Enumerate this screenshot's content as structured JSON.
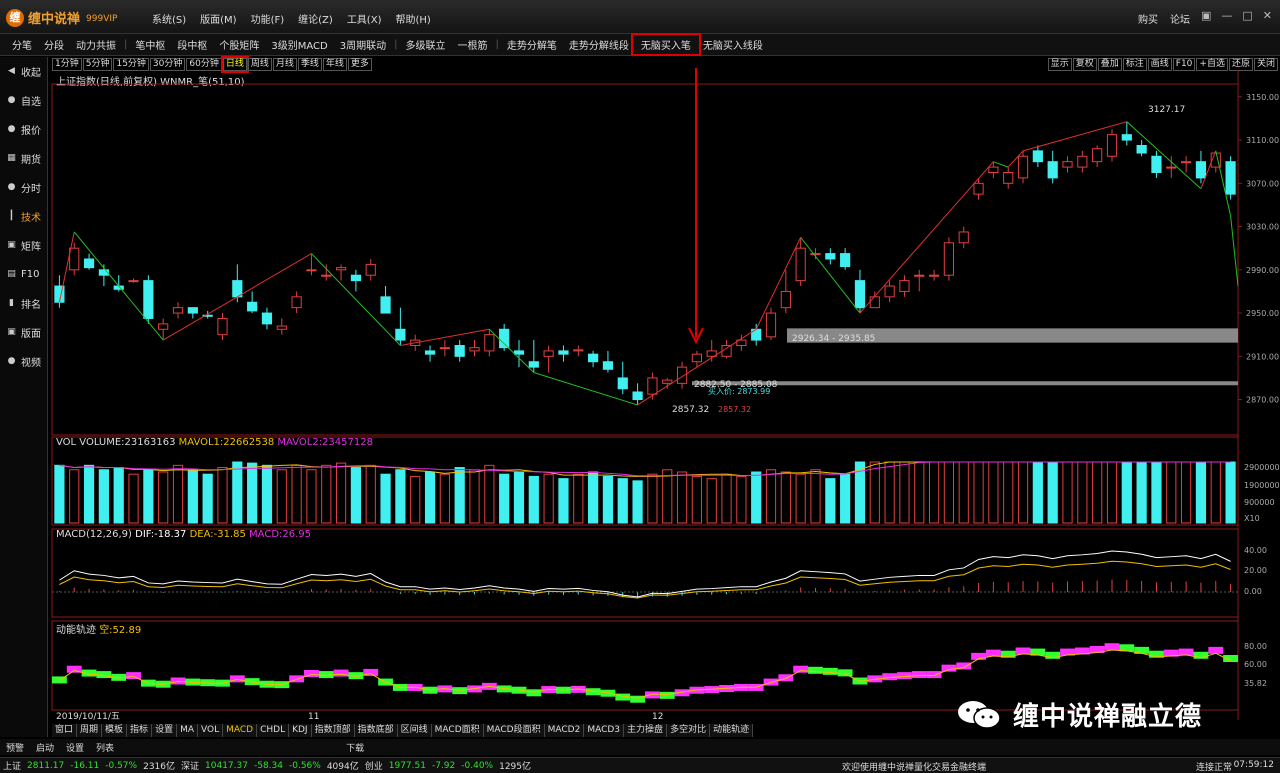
{
  "app": {
    "title": "缠中说禅",
    "vip": "999VIP",
    "logo_glyph": "缠",
    "menu": [
      "系统(S)",
      "版面(M)",
      "功能(F)",
      "缠论(Z)",
      "工具(X)",
      "帮助(H)"
    ],
    "top_right": [
      "购买",
      "论坛"
    ],
    "window_buttons": [
      "▣",
      "—",
      "□",
      "✕"
    ]
  },
  "toolbar": [
    "分笔",
    "分段",
    "动力共振",
    "|",
    "笔中枢",
    "段中枢",
    "个股矩阵",
    "3级别MACD",
    "3周期联动",
    "|",
    "多级联立",
    "一根筋",
    "|",
    "走势分解笔",
    "走势分解线段",
    "无脑买入笔",
    "无脑买入线段"
  ],
  "toolbar_highlight": "无脑买入笔",
  "sidebar": [
    {
      "label": "收起",
      "icon": "chevron-left-icon",
      "glyph": "◀"
    },
    {
      "label": "自选",
      "icon": "star-icon",
      "glyph": "●"
    },
    {
      "label": "报价",
      "icon": "quote-icon",
      "glyph": "●"
    },
    {
      "label": "期货",
      "icon": "futures-icon",
      "glyph": "▦"
    },
    {
      "label": "分时",
      "icon": "clock-icon",
      "glyph": "●"
    },
    {
      "label": "技术",
      "icon": "candlestick-icon",
      "glyph": "┃"
    },
    {
      "label": "矩阵",
      "icon": "matrix-icon",
      "glyph": "▣"
    },
    {
      "label": "F10",
      "icon": "f10-icon",
      "glyph": "▤"
    },
    {
      "label": "排名",
      "icon": "ranking-icon",
      "glyph": "▮"
    },
    {
      "label": "版面",
      "icon": "layout-icon",
      "glyph": "▣"
    },
    {
      "label": "视频",
      "icon": "video-icon",
      "glyph": "●"
    }
  ],
  "sidebar_active": "技术",
  "periods": [
    "1分钟",
    "5分钟",
    "15分钟",
    "30分钟",
    "60分钟",
    "日线",
    "周线",
    "月线",
    "季线",
    "年线",
    "更多"
  ],
  "period_active": "日线",
  "right_tools": [
    "显示",
    "复权",
    "叠加",
    "标注",
    "画线",
    "F10",
    "+自选",
    "还原",
    "关闭"
  ],
  "chart_title": "上证指数(日线,前复权) WNMR_笔(51,10)",
  "vol_label": "VOL VOLUME:23163163",
  "vol_ma1": "MAVOL1:22662538",
  "vol_ma2": "MAVOL2:23457128",
  "macd_label": "MACD(12,26,9)",
  "macd_dif": "DIF:-18.37",
  "macd_dea": "DEA:-31.85",
  "macd_val": "MACD:26.95",
  "dn_label": "动能轨迹",
  "dn_val": "空:52.89",
  "annotations": {
    "high": "3127.17",
    "low": "2857.32",
    "zone1": "2926.34 - 2935.85",
    "zone2": "2882.50 - 2885.08",
    "buy_price": "买入价: 2873.99",
    "buy_point": "2857.32"
  },
  "price_axis": [
    "3150.00",
    "3110.00",
    "3070.00",
    "3030.00",
    "2990.00",
    "2950.00",
    "2910.00",
    "2870.00"
  ],
  "vol_axis": [
    "2900000",
    "1900000",
    "900000",
    "X10"
  ],
  "macd_axis": [
    "40.00",
    "20.00",
    "0.00"
  ],
  "dn_axis": [
    "80.00",
    "60.00",
    "35.82"
  ],
  "date_axis": {
    "start": "2019/10/11/五",
    "m11": "11",
    "m12": "12"
  },
  "bottom_tabs": [
    "窗口",
    "周期",
    "模板",
    "指标",
    "设置",
    "MA",
    "VOL",
    "MACD",
    "CHDL",
    "KDJ",
    "指数顶部",
    "指数底部",
    "区间线",
    "MACD面积",
    "MACD段面积",
    "MACD2",
    "MACD3",
    "主力操盘",
    "多空对比",
    "动能轨迹"
  ],
  "bottom_tab_active": "MACD",
  "bottom_bar": [
    "预警",
    "启动",
    "设置",
    "列表",
    "下载"
  ],
  "status": {
    "sh_name": "上证",
    "sh_val": "2811.17",
    "sh_chg": "-16.11",
    "sh_pct": "-0.57%",
    "sh_amt": "2316亿",
    "sz_name": "深证",
    "sz_val": "10417.37",
    "sz_chg": "-58.34",
    "sz_pct": "-0.56%",
    "sz_amt": "4094亿",
    "cy_name": "创业",
    "cy_val": "1977.51",
    "cy_chg": "-7.92",
    "cy_pct": "-0.40%",
    "cy_amt": "1295亿",
    "message": "欢迎使用缠中说禅量化交易金融终端",
    "conn": "连接正常",
    "time": "07:59:12"
  },
  "watermark": "缠中说禅融立德",
  "colors": {
    "up": "#e04040",
    "down": "#40f0f0",
    "accent": "#f0a030",
    "highlight": "#e00000",
    "bi_up": "#e03030",
    "bi_down": "#20c020"
  },
  "chart_data": {
    "type": "candlestick",
    "ohlc": [
      [
        2975,
        2985,
        2955,
        2960
      ],
      [
        2990,
        3015,
        2985,
        3010
      ],
      [
        3000,
        3005,
        2990,
        2992
      ],
      [
        2990,
        2995,
        2975,
        2985
      ],
      [
        2975,
        2985,
        2970,
        2972
      ],
      [
        2980,
        2982,
        2978,
        2980
      ],
      [
        2980,
        2985,
        2940,
        2945
      ],
      [
        2935,
        2945,
        2925,
        2940
      ],
      [
        2950,
        2960,
        2945,
        2955
      ],
      [
        2955,
        2955,
        2945,
        2950
      ],
      [
        2948,
        2952,
        2945,
        2947
      ],
      [
        2930,
        2950,
        2925,
        2945
      ],
      [
        2980,
        2995,
        2960,
        2965
      ],
      [
        2960,
        2970,
        2950,
        2952
      ],
      [
        2950,
        2955,
        2935,
        2940
      ],
      [
        2935,
        2945,
        2930,
        2938
      ],
      [
        2955,
        2970,
        2950,
        2965
      ],
      [
        2990,
        3005,
        2985,
        2990
      ],
      [
        2985,
        2995,
        2980,
        2985
      ],
      [
        2990,
        2995,
        2980,
        2992
      ],
      [
        2985,
        2990,
        2970,
        2980
      ],
      [
        2985,
        3000,
        2980,
        2995
      ],
      [
        2965,
        2975,
        2950,
        2950
      ],
      [
        2935,
        2955,
        2920,
        2925
      ],
      [
        2920,
        2930,
        2915,
        2925
      ],
      [
        2915,
        2920,
        2905,
        2912
      ],
      [
        2918,
        2925,
        2910,
        2918
      ],
      [
        2920,
        2925,
        2905,
        2910
      ],
      [
        2915,
        2925,
        2910,
        2918
      ],
      [
        2915,
        2935,
        2910,
        2930
      ],
      [
        2935,
        2940,
        2915,
        2918
      ],
      [
        2915,
        2925,
        2900,
        2912
      ],
      [
        2905,
        2925,
        2895,
        2900
      ],
      [
        2910,
        2920,
        2895,
        2915
      ],
      [
        2915,
        2920,
        2905,
        2912
      ],
      [
        2915,
        2920,
        2910,
        2916
      ],
      [
        2912,
        2915,
        2900,
        2905
      ],
      [
        2905,
        2915,
        2895,
        2898
      ],
      [
        2890,
        2905,
        2875,
        2880
      ],
      [
        2877,
        2885,
        2865,
        2870
      ],
      [
        2875,
        2895,
        2870,
        2890
      ],
      [
        2885,
        2890,
        2880,
        2888
      ],
      [
        2885,
        2905,
        2880,
        2900
      ],
      [
        2905,
        2915,
        2900,
        2912
      ],
      [
        2910,
        2925,
        2905,
        2915
      ],
      [
        2910,
        2925,
        2908,
        2920
      ],
      [
        2920,
        2930,
        2915,
        2925
      ],
      [
        2935,
        2940,
        2920,
        2925
      ],
      [
        2928,
        2955,
        2925,
        2950
      ],
      [
        2955,
        2990,
        2950,
        2970
      ],
      [
        2980,
        3020,
        2975,
        3010
      ],
      [
        3005,
        3010,
        3000,
        3005
      ],
      [
        3005,
        3010,
        2995,
        3000
      ],
      [
        3005,
        3010,
        2990,
        2993
      ],
      [
        2980,
        2990,
        2950,
        2955
      ],
      [
        2955,
        2970,
        2955,
        2965
      ],
      [
        2965,
        2980,
        2960,
        2975
      ],
      [
        2970,
        2985,
        2965,
        2980
      ],
      [
        2985,
        2990,
        2970,
        2985
      ],
      [
        2985,
        2990,
        2980,
        2985
      ],
      [
        2985,
        3020,
        2980,
        3015
      ],
      [
        3015,
        3030,
        3010,
        3025
      ],
      [
        3060,
        3075,
        3055,
        3070
      ],
      [
        3080,
        3090,
        3075,
        3085
      ],
      [
        3070,
        3085,
        3065,
        3080
      ],
      [
        3075,
        3100,
        3070,
        3095
      ],
      [
        3100,
        3105,
        3085,
        3090
      ],
      [
        3090,
        3100,
        3070,
        3075
      ],
      [
        3085,
        3095,
        3080,
        3090
      ],
      [
        3085,
        3100,
        3080,
        3095
      ],
      [
        3090,
        3105,
        3085,
        3102
      ],
      [
        3095,
        3120,
        3090,
        3115
      ],
      [
        3115,
        3127,
        3105,
        3110
      ],
      [
        3105,
        3110,
        3095,
        3098
      ],
      [
        3095,
        3100,
        3075,
        3080
      ],
      [
        3085,
        3095,
        3075,
        3085
      ],
      [
        3090,
        3095,
        3080,
        3090
      ],
      [
        3090,
        3100,
        3070,
        3075
      ],
      [
        3085,
        3100,
        3080,
        3098
      ],
      [
        3090,
        3095,
        3055,
        3060
      ]
    ],
    "volume": [
      1.3,
      1.2,
      1.3,
      1.2,
      1.25,
      1.1,
      1.2,
      1.15,
      1.3,
      1.2,
      1.1,
      1.25,
      1.4,
      1.35,
      1.3,
      1.2,
      1.3,
      1.2,
      1.3,
      1.35,
      1.25,
      1.3,
      1.1,
      1.2,
      1.05,
      1.15,
      1.1,
      1.25,
      1.2,
      1.3,
      1.1,
      1.15,
      1.05,
      1.1,
      1.0,
      1.1,
      1.15,
      1.05,
      1.0,
      0.95,
      1.1,
      1.2,
      1.15,
      1.05,
      1.0,
      1.1,
      1.05,
      1.15,
      1.2,
      1.15,
      1.1,
      1.2,
      1.0,
      1.1,
      1.6,
      1.7,
      1.5,
      1.6,
      1.7,
      1.65,
      1.8,
      1.9,
      2.0,
      2.1,
      1.95,
      1.7,
      1.8,
      1.7,
      1.9,
      1.75,
      1.85,
      1.7,
      1.8,
      1.6,
      1.55,
      1.65,
      1.7,
      1.65,
      2.0,
      1.95
    ],
    "price_range": [
      2840,
      3160
    ]
  }
}
